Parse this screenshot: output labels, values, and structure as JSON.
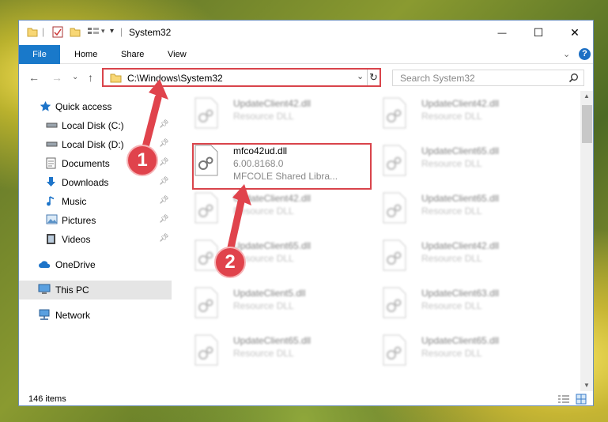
{
  "window": {
    "title": "System32"
  },
  "window_controls": {
    "minimize": "—",
    "maximize": "☐",
    "close": "✕"
  },
  "ribbon": {
    "file": "File",
    "tabs": [
      "Home",
      "Share",
      "View"
    ],
    "help": "?"
  },
  "address": {
    "path": "C:\\Windows\\System32",
    "search_placeholder": "Search System32"
  },
  "sidebar": {
    "items": [
      {
        "label": "Quick access",
        "icon": "star-icon"
      },
      {
        "label": "Local Disk (C:)",
        "icon": "drive-icon",
        "pinned": true
      },
      {
        "label": "Local Disk (D:)",
        "icon": "drive-icon",
        "pinned": true
      },
      {
        "label": "Documents",
        "icon": "documents-icon",
        "pinned": true
      },
      {
        "label": "Downloads",
        "icon": "download-icon",
        "pinned": true
      },
      {
        "label": "Music",
        "icon": "music-icon",
        "pinned": true
      },
      {
        "label": "Pictures",
        "icon": "pictures-icon",
        "pinned": true
      },
      {
        "label": "Videos",
        "icon": "videos-icon",
        "pinned": true
      },
      {
        "label": "OneDrive",
        "icon": "cloud-icon"
      },
      {
        "label": "This PC",
        "icon": "computer-icon",
        "selected": true
      },
      {
        "label": "Network",
        "icon": "network-icon"
      }
    ]
  },
  "files": {
    "left": [
      {
        "name": "UpdateClient42.dll",
        "type": "Resource DLL"
      },
      {
        "name": "mfco42ud.dll",
        "version": "6.00.8168.0",
        "type": "MFCOLE Shared Libra..."
      },
      {
        "name": "UpdateClient42.dll",
        "type": "Resource DLL"
      },
      {
        "name": "UpdateClient65.dll",
        "type": "Resource DLL"
      },
      {
        "name": "UpdateClient5.dll",
        "type": "Resource DLL"
      },
      {
        "name": "UpdateClient65.dll",
        "type": "Resource DLL"
      }
    ],
    "right": [
      {
        "name": "UpdateClient42.dll",
        "type": "Resource DLL"
      },
      {
        "name": "UpdateClient65.dll",
        "type": "Resource DLL"
      },
      {
        "name": "UpdateClient65.dll",
        "type": "Resource DLL"
      },
      {
        "name": "UpdateClient42.dll",
        "type": "Resource DLL"
      },
      {
        "name": "UpdateClient63.dll",
        "type": "Resource DLL"
      },
      {
        "name": "UpdateClient65.dll",
        "type": "Resource DLL"
      }
    ]
  },
  "status": {
    "item_count": "146 items"
  },
  "annotations": {
    "step1": "1",
    "step2": "2"
  },
  "colors": {
    "accent": "#1979ca",
    "highlight": "#d9444b",
    "selected_bg": "#e5e5e5"
  }
}
